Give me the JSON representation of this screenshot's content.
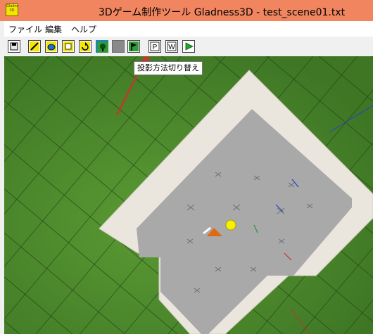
{
  "window": {
    "title": "3Dゲーム制作ツール Gladness3D - test_scene01.txt",
    "icon_label": "Gladness 3D",
    "icon_name": "app-icon"
  },
  "menu": {
    "items": [
      {
        "label": "ファイル"
      },
      {
        "label": "編集"
      },
      {
        "label": "ヘルプ"
      }
    ]
  },
  "toolbar": {
    "buttons": [
      {
        "name": "save-icon"
      },
      {
        "name": "pencil-icon"
      },
      {
        "name": "open-icon"
      },
      {
        "name": "add-icon"
      },
      {
        "name": "rotate-icon"
      },
      {
        "name": "tree-icon"
      },
      {
        "name": "blank-icon"
      },
      {
        "name": "flag-icon"
      },
      {
        "name": "projection-p-icon",
        "label": "P"
      },
      {
        "name": "w-icon",
        "label": "W"
      },
      {
        "name": "play-icon"
      }
    ]
  },
  "tooltip": {
    "text": "投影方法切り替え"
  },
  "colors": {
    "titlebar": "#f0855f",
    "grass": "#4c8a2a",
    "platform": "#a9a9a9",
    "border": "#ebe6dd",
    "arrow": "#c0392b",
    "active_button": "#8a8a8a"
  }
}
